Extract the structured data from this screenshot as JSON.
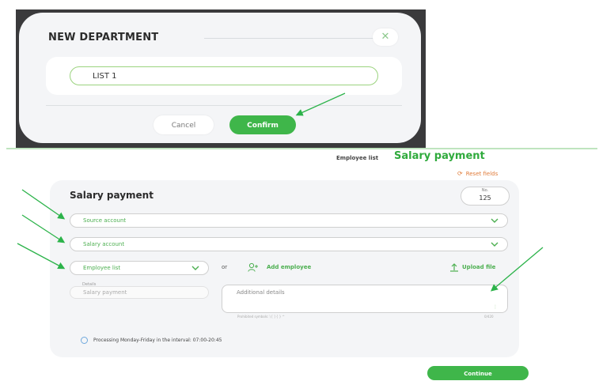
{
  "colors": {
    "accent": "#3fb64a",
    "accent_text": "#4caf50",
    "input_border": "#9bd37f",
    "annotation_arrow": "#2cb34a",
    "reset_link": "#e07b39",
    "info_icon": "#6ea8dc",
    "backdrop": "#3a3a3c"
  },
  "dialog": {
    "title": "NEW DEPARTMENT",
    "close_icon": "close-icon",
    "name_value": "LIST 1",
    "cancel_label": "Cancel",
    "confirm_label": "Confirm"
  },
  "header": {
    "employee_list_label": "Employee list",
    "page_title": "Salary payment",
    "reset_label": "Reset fields",
    "reset_icon": "refresh-icon"
  },
  "form": {
    "title": "Salary payment",
    "number_label": "No.",
    "number_value": "125",
    "source_account_placeholder": "Source account",
    "salary_account_placeholder": "Salary account",
    "employee_list_select": "Employee list",
    "or_text": "or",
    "add_employee_label": "Add employee",
    "add_employee_icon": "add-user-icon",
    "upload_file_label": "Upload file",
    "upload_icon": "upload-icon",
    "details_label": "Details",
    "details_value": "Salary payment",
    "additional_details_placeholder": "Additional details",
    "prohibited_symbols": "Prohibited symbols: \\ [ ] { } ^",
    "char_counter": "0/420",
    "processing_info": "Processing Monday-Friday in the interval: 07:00-20:45",
    "info_icon": "info-icon",
    "continue_label": "Continue"
  }
}
